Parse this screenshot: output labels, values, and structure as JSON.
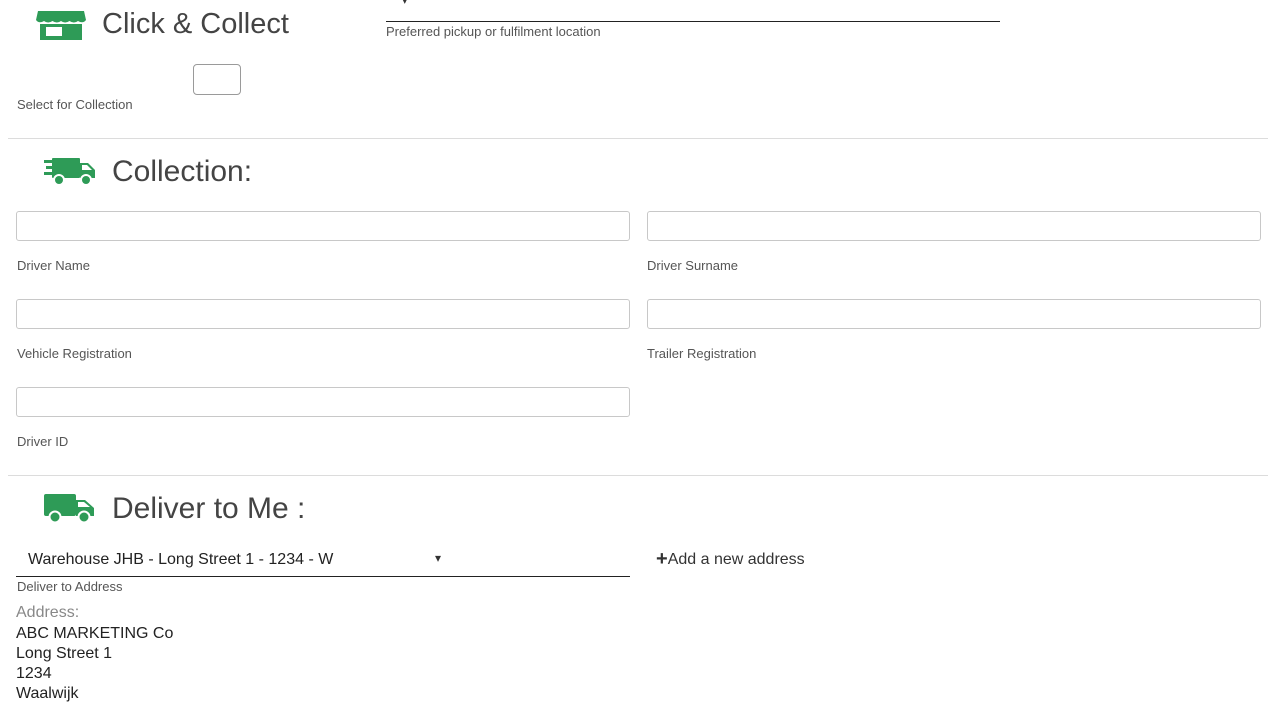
{
  "click_collect": {
    "title": "Click & Collect",
    "location_field_helper": "Preferred pickup or fulfilment location",
    "checkbox_label": "Select for Collection"
  },
  "collection": {
    "title": "Collection:",
    "fields": {
      "driver_name": {
        "label": "Driver Name",
        "value": ""
      },
      "driver_surname": {
        "label": "Driver Surname",
        "value": ""
      },
      "vehicle_registration": {
        "label": "Vehicle Registration",
        "value": ""
      },
      "trailer_registration": {
        "label": "Trailer Registration",
        "value": ""
      },
      "driver_id": {
        "label": "Driver ID",
        "value": ""
      }
    }
  },
  "delivery": {
    "title": "Deliver to Me :",
    "address_select": {
      "selected": "Warehouse JHB - Long Street 1 - 1234 - W",
      "label": "Deliver to Address"
    },
    "add_address_label": "Add a new address",
    "address": {
      "heading": "Address:",
      "lines": [
        "ABC MARKETING Co",
        "Long Street 1",
        "1234",
        "Waalwijk"
      ]
    }
  },
  "icons": {
    "store": "store-icon",
    "fast_truck": "fast-truck-icon",
    "truck": "truck-icon",
    "plus": "plus-icon",
    "caret": "caret-down-icon"
  },
  "colors": {
    "icon_green": "#2e9b57"
  }
}
